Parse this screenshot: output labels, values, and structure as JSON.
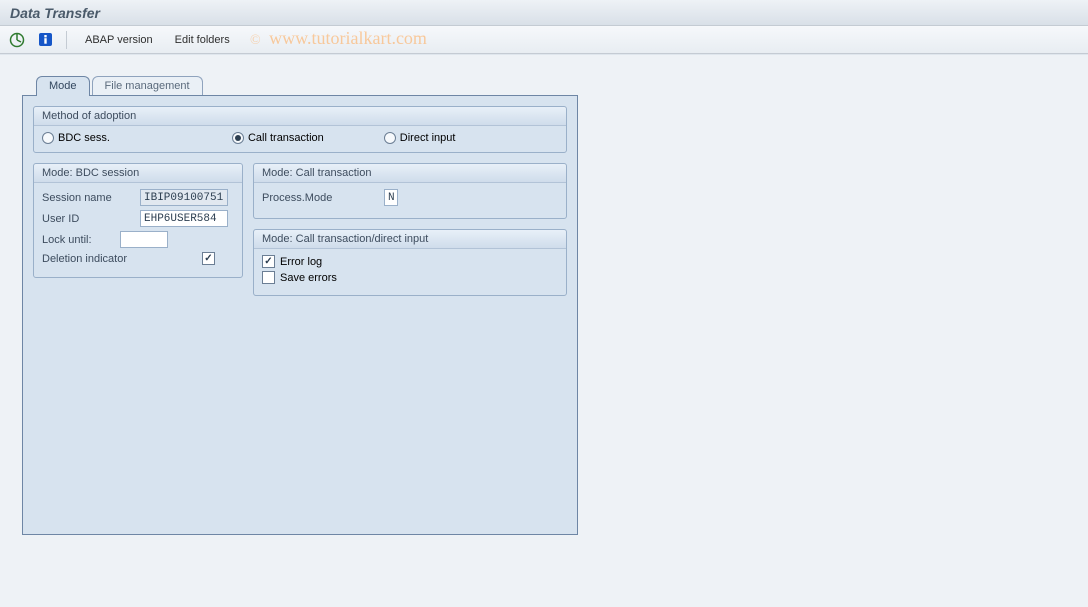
{
  "title": "Data Transfer",
  "toolbar": {
    "execute_icon": "execute-icon",
    "info_icon": "info-icon",
    "abap_version": "ABAP version",
    "edit_folders": "Edit folders"
  },
  "watermark": {
    "copy": "©",
    "text": "www.tutorialkart.com"
  },
  "tabs": {
    "mode": "Mode",
    "file_mgmt": "File management"
  },
  "group_method": {
    "title": "Method of adoption",
    "bdc": "BDC sess.",
    "call_tx": "Call transaction",
    "direct": "Direct input",
    "selected": "call_tx"
  },
  "group_bdc": {
    "title": "Mode: BDC session",
    "session_name_label": "Session name",
    "session_name_value": "IBIP09100751",
    "user_id_label": "User ID",
    "user_id_value": "EHP6USER584",
    "lock_until_label": "Lock until:",
    "lock_until_value": "",
    "deletion_label": "Deletion indicator",
    "deletion_checked": true
  },
  "group_calltx": {
    "title": "Mode: Call transaction",
    "process_mode_label": "Process.Mode",
    "process_mode_value": "N"
  },
  "group_ctdi": {
    "title": "Mode: Call transaction/direct input",
    "error_log_label": "Error log",
    "error_log_checked": true,
    "save_errors_label": "Save errors",
    "save_errors_checked": false
  }
}
